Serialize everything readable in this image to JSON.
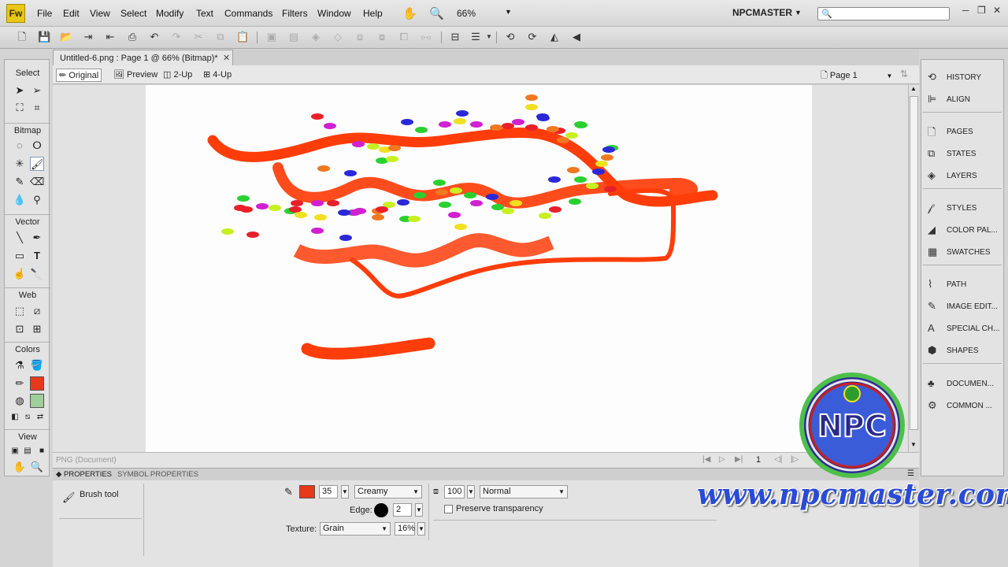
{
  "app": {
    "logo_text": "Fw",
    "workspace": "NPCMASTER",
    "search_placeholder": ""
  },
  "menu": {
    "items": [
      "File",
      "Edit",
      "View",
      "Select",
      "Modify",
      "Text",
      "Commands",
      "Filters",
      "Window",
      "Help"
    ]
  },
  "zoom": {
    "value": "66%"
  },
  "document": {
    "tab_title": "Untitled-6.png : Page 1 @ 66% (Bitmap)*",
    "views": [
      "Original",
      "Preview",
      "2-Up",
      "4-Up"
    ],
    "page_select": "Page 1",
    "status": "PNG (Document)",
    "page_number": "1"
  },
  "tools": {
    "sections": [
      "Select",
      "Bitmap",
      "Vector",
      "Web",
      "Colors",
      "View"
    ],
    "stroke_color": "#e8381a",
    "fill_color": "#9fcf9a"
  },
  "right_panels": [
    {
      "icon": "history-icon",
      "label": "HISTORY"
    },
    {
      "icon": "align-icon",
      "label": "ALIGN"
    },
    {
      "icon": "pages-icon",
      "label": "PAGES"
    },
    {
      "icon": "states-icon",
      "label": "STATES"
    },
    {
      "icon": "layers-icon",
      "label": "LAYERS"
    },
    {
      "icon": "styles-icon",
      "label": "STYLES"
    },
    {
      "icon": "color-palette-icon",
      "label": "COLOR PAL..."
    },
    {
      "icon": "swatches-icon",
      "label": "SWATCHES"
    },
    {
      "icon": "path-icon",
      "label": "PATH"
    },
    {
      "icon": "image-edit-icon",
      "label": "IMAGE EDIT..."
    },
    {
      "icon": "special-chars-icon",
      "label": "SPECIAL CH..."
    },
    {
      "icon": "shapes-icon",
      "label": "SHAPES"
    },
    {
      "icon": "document-icon",
      "label": "DOCUMEN..."
    },
    {
      "icon": "common-library-icon",
      "label": "COMMON ..."
    }
  ],
  "properties": {
    "tabs": [
      "PROPERTIES",
      "SYMBOL PROPERTIES"
    ],
    "tool_name": "Brush tool",
    "brush_color": "#e8381a",
    "tip_size": "35",
    "stroke_category": "Creamy",
    "edge_label": "Edge:",
    "edge_value": "2",
    "texture_label": "Texture:",
    "texture": "Grain",
    "texture_amount": "16%",
    "opacity": "100",
    "blend_mode": "Normal",
    "preserve_transparency_label": "Preserve transparency",
    "preserve_transparency": false
  },
  "watermark": {
    "url_text": "www.npcmaster.com",
    "logo_text": "NPC"
  },
  "colors": {
    "stroke": "#ff3d0a",
    "dots": [
      "#e8202a",
      "#d020d0",
      "#2a28d8",
      "#2ad030",
      "#f07820",
      "#c8f020",
      "#f0e020"
    ]
  }
}
